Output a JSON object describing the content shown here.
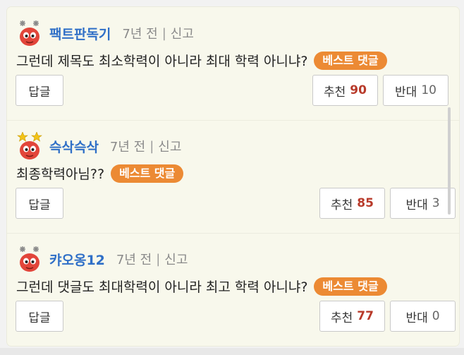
{
  "comments": [
    {
      "nickname": "팩트판독기",
      "time": "7년 전",
      "separator": "|",
      "report": "신고",
      "text": "그런데 제목도 최소학력이 아니라 최대 학력 아니냐?",
      "badge": "베스트 댓글",
      "reply_label": "답글",
      "up_label": "추천",
      "up_count": "90",
      "down_label": "반대",
      "down_count": "10",
      "avatar_icon": "gray-sparkle-mascot-icon"
    },
    {
      "nickname": "슥삭슥삭",
      "time": "7년 전",
      "separator": "|",
      "report": "신고",
      "text": "최종학력아님??",
      "badge": "베스트 댓글",
      "reply_label": "답글",
      "up_label": "추천",
      "up_count": "85",
      "down_label": "반대",
      "down_count": "3",
      "avatar_icon": "gold-star-mascot-icon"
    },
    {
      "nickname": "캬오옹12",
      "time": "7년 전",
      "separator": "|",
      "report": "신고",
      "text": "그런데 댓글도 최대학력이 아니라 최고 학력 아니냐?",
      "badge": "베스트 댓글",
      "reply_label": "답글",
      "up_label": "추천",
      "up_count": "77",
      "down_label": "반대",
      "down_count": "0",
      "avatar_icon": "gray-sparkle-mascot-icon"
    }
  ],
  "colors": {
    "panel_bg": "#f8f8ec",
    "nickname": "#2f6fc7",
    "badge_bg": "#ec8a34",
    "up_count": "#b83a2a",
    "mascot_red": "#e2453a"
  }
}
